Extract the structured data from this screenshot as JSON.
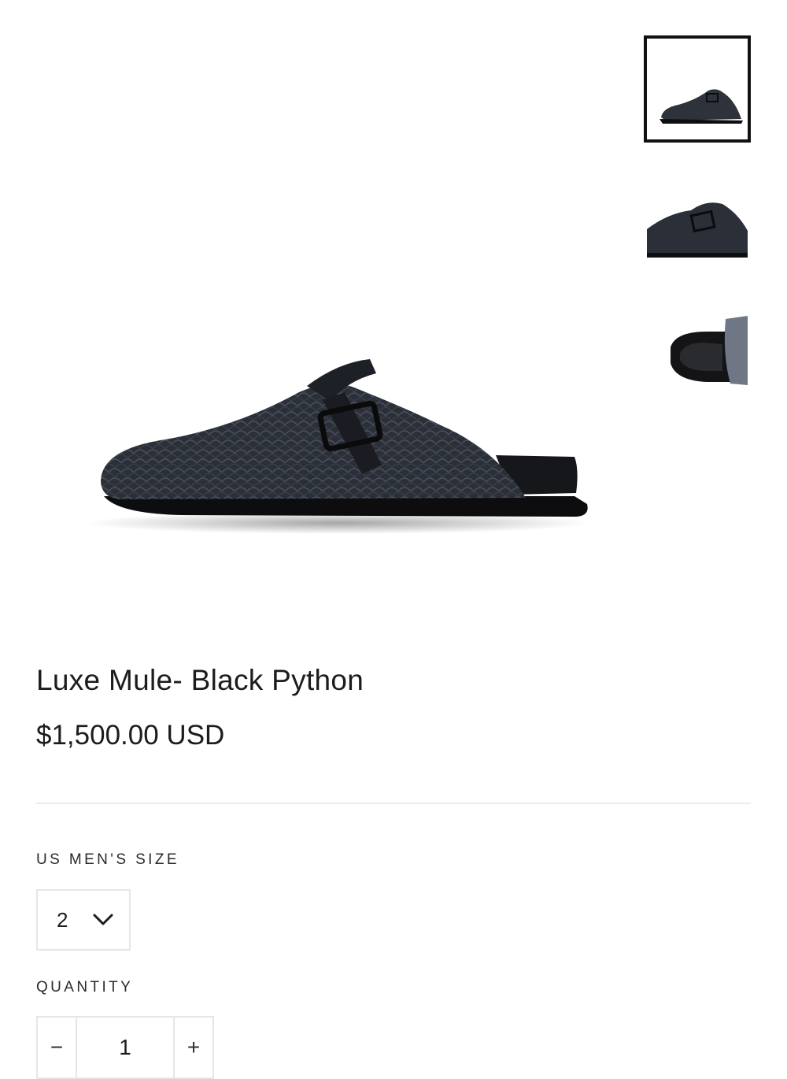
{
  "product": {
    "title": "Luxe Mule- Black Python",
    "price": "$1,500.00 USD",
    "main_image": "black-python-mule-side-view",
    "thumbnails": [
      {
        "image": "mule-side-view",
        "active": true
      },
      {
        "image": "mule-closeup-buckle",
        "active": false
      },
      {
        "image": "mule-footbed-top-view",
        "active": false
      }
    ]
  },
  "size": {
    "label": "US MEN'S SIZE",
    "selected": "2",
    "icon": "chevron-down-icon"
  },
  "quantity": {
    "label": "QUANTITY",
    "decrement_symbol": "−",
    "value": "1",
    "increment_symbol": "+"
  },
  "colors": {
    "text": "#1c1c1c",
    "border": "#e6e6e6",
    "active_thumb_border": "#111111"
  }
}
